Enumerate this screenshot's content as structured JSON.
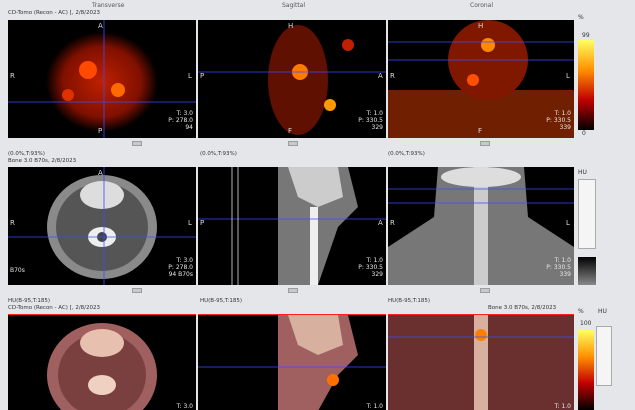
{
  "views": [
    "Transverse",
    "Sagittal",
    "Coronal"
  ],
  "rows": [
    {
      "header_left": "CD-Tomo (Recon - AC) [, 2/8/2023",
      "header_mid": "",
      "header_right": "",
      "labels": [
        "(0.0%,T:93%)",
        "(0.0%,T:93%)",
        "(0.0%,T:93%)"
      ],
      "ov": [
        {
          "t": "T: 3.0",
          "p": "P: 278.0",
          "n": "94"
        },
        {
          "t": "T: 1.0",
          "p": "P: 330.5",
          "n": "329"
        },
        {
          "t": "T: 1.0",
          "p": "P: 330.5",
          "n": "339"
        }
      ],
      "scale_top": "%",
      "scale_hi": "99",
      "scale_lo": "0"
    },
    {
      "header_left": "Bone  3.0  B70s, 2/8/2023",
      "labels": [
        "HU(B-95,T:185)",
        "HU(B-95,T:185)",
        "HU(B-95,T:185)"
      ],
      "ov": [
        {
          "t": "T: 3.0",
          "p": "P: 278.0",
          "n": "94 B70s"
        },
        {
          "t": "T: 1.0",
          "p": "P: 330.5",
          "n": "329"
        },
        {
          "t": "T: 1.0",
          "p": "P: 330.5",
          "n": "339"
        }
      ],
      "extra": "B70s",
      "scale_top": "HU"
    },
    {
      "header_left": "CD-Tomo (Recon - AC) [, 2/8/2023",
      "header_right": "Bone  3.0  B70s, 2/8/2023",
      "ov": [
        {
          "t": "T: 3.0"
        },
        {
          "t": "T: 1.0"
        },
        {
          "t": "T: 1.0"
        }
      ],
      "scale_top": "%",
      "scale_hi": "100",
      "scale_lo": "50",
      "scale_top2": "HU"
    }
  ],
  "orient": {
    "A": "A",
    "P": "P",
    "R": "R",
    "L": "L",
    "H": "H",
    "F": "F"
  },
  "colors": {
    "pet_hot": "#ff5a00",
    "crosshair": "#3c4cff",
    "frame": "#ff2020"
  }
}
